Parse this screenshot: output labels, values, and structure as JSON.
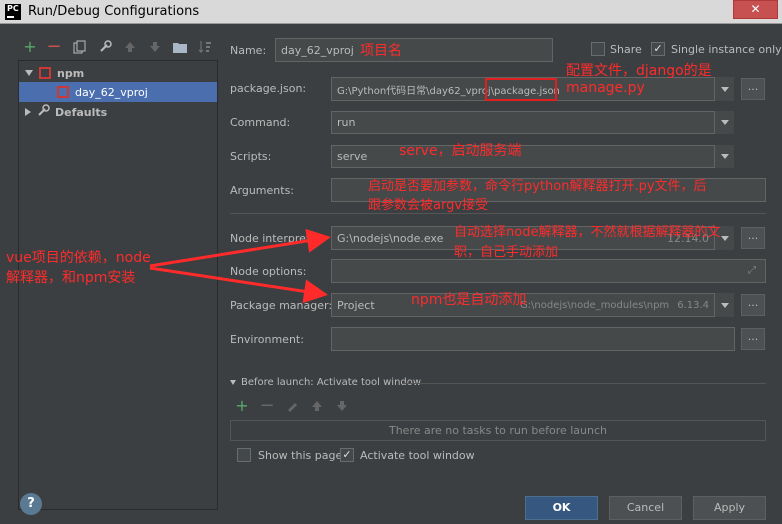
{
  "window": {
    "title": "Run/Debug Configurations",
    "close": "✕"
  },
  "left": {
    "tree": [
      {
        "label": "npm"
      },
      {
        "label": "day_62_vproj"
      },
      {
        "label": "Defaults"
      }
    ]
  },
  "form": {
    "name_label": "Name:",
    "name_value": "day_62_vproj",
    "share_label": "Share",
    "single_instance_label": "Single instance only",
    "package_json_label": "package.json:",
    "package_json_value": "G:\\Python代码日常\\day62_vproj\\package.json",
    "command_label": "Command:",
    "command_value": "run",
    "scripts_label": "Scripts:",
    "scripts_value": "serve",
    "arguments_label": "Arguments:",
    "node_interpreter_label": "Node interpreter:",
    "node_interpreter_value": "G:\\nodejs\\node.exe",
    "node_version": "12.14.0",
    "node_options_label": "Node options:",
    "package_manager_label": "Package manager:",
    "package_manager_value": "Project",
    "package_manager_path": "G:\\nodejs\\node_modules\\npm",
    "npm_version": "6.13.4",
    "environment_label": "Environment:",
    "dots": "..."
  },
  "before_launch": {
    "title": "Before launch: Activate tool window",
    "empty_text": "There are no tasks to run before launch",
    "show_page_label": "Show this page",
    "activate_tool_label": "Activate tool window"
  },
  "buttons": {
    "ok": "OK",
    "cancel": "Cancel",
    "apply": "Apply",
    "help": "?"
  },
  "annotations": {
    "project_name": "项目名",
    "config_line1": "配置文件，django的是",
    "config_line2": "manage.py",
    "serve_note": "serve，启动服务端",
    "args_line1": "启动是否要加参数，命令行python解释器打开.py文件，后",
    "args_line2": "跟参数会被argv接受",
    "interp_line1": "自动选择node解释器，不然就根据解释器的文",
    "interp_line2": "职，自己手动添加",
    "vue_line1": "vue项目的依赖，node",
    "vue_line2": "解释器，和npm安装",
    "npm_auto": "npm也是自动添加"
  },
  "colors": {
    "accent": "#4b6eaf",
    "annotation": "#ff2b2b",
    "ok": "#365880"
  }
}
